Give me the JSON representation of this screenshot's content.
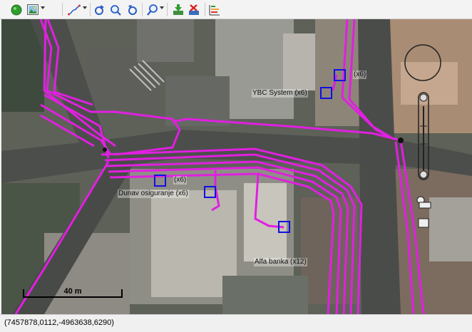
{
  "toolbar": {
    "buttons": [
      {
        "name": "layer-icon",
        "color": "#2e9d2e"
      },
      {
        "name": "image-layer-icon"
      },
      {
        "name": "route-icon"
      },
      {
        "name": "refresh-icon"
      },
      {
        "name": "zoom-area-icon"
      },
      {
        "name": "pan-refresh-icon"
      },
      {
        "name": "zoom-icon"
      },
      {
        "name": "download-icon"
      },
      {
        "name": "delete-icon"
      },
      {
        "name": "chart-icon"
      }
    ]
  },
  "map": {
    "route_color": "#e020e0",
    "marker_color": "#1010e0",
    "labels": {
      "ybc_top": "(x6)",
      "ybc": "YBC System (x6)",
      "dunav_top": "(x6)",
      "dunav": "Dunav osiguranje (x6)",
      "alfa": "Alfa banka (x12)"
    },
    "scale_label": "40 m"
  },
  "status": {
    "coordinates": "(7457878,0112,-4963638,6290)"
  }
}
